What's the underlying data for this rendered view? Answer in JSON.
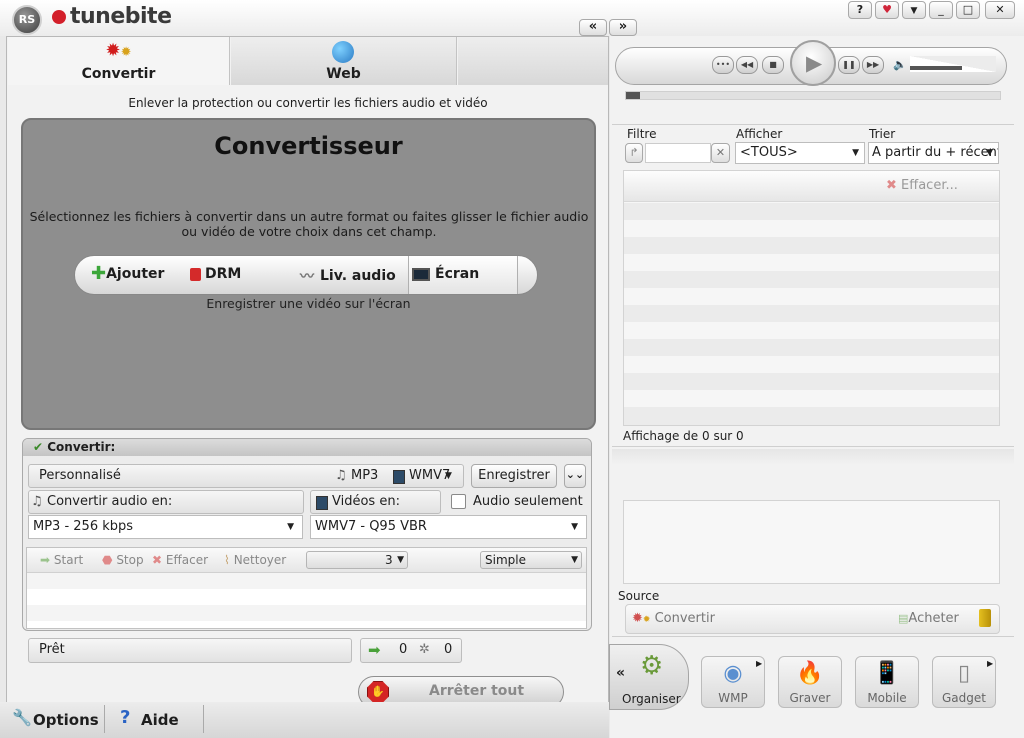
{
  "app": {
    "name": "tunebite",
    "badge": "RS"
  },
  "window_controls": {
    "collapse_left": "«",
    "expand_right": "»",
    "help": "?",
    "minimize": "_",
    "maximize": "□",
    "close": "✕"
  },
  "tabs": [
    {
      "label": "Convertir"
    },
    {
      "label": "Web"
    }
  ],
  "subtitle": "Enlever la protection ou convertir les fichiers audio et vidéo",
  "converter": {
    "title": "Convertisseur",
    "description": "Sélectionnez les fichiers à convertir dans un autre format ou faites glisser le fichier audio ou vidéo de votre choix dans cet champ.",
    "actions": {
      "add": "Ajouter",
      "drm": "DRM",
      "live_audio": "Liv. audio",
      "screen": "Écran"
    },
    "screen_hint": "Enregistrer une vidéo sur l'écran"
  },
  "convert_section": {
    "header": "Convertir:",
    "profile": "Personnalisé",
    "audio_format_badge": "MP3",
    "video_format_badge": "WMV7",
    "record_label": "Enregistrer",
    "audio_label": "Convertir audio en:",
    "video_label": "Vidéos en:",
    "audio_only_label": "Audio seulement",
    "audio_value": "MP3 - 256 kbps",
    "video_value": "WMV7 - Q95 VBR",
    "queue_toolbar": {
      "start": "Start",
      "stop": "Stop",
      "clear": "Effacer",
      "clean": "Nettoyer",
      "threads": "3",
      "mode": "Simple"
    }
  },
  "status": {
    "text": "Prêt",
    "done_count": "0",
    "processing_count": "0"
  },
  "stop_all_label": "Arrêter tout",
  "bottom": {
    "options": "Options",
    "help": "Aide"
  },
  "library": {
    "filter_label": "Filtre",
    "show_label": "Afficher",
    "sort_label": "Trier",
    "show_value": "<TOUS>",
    "sort_value": "A partir du + récent",
    "clear_label": "Effacer...",
    "count_text": "Affichage de 0 sur 0",
    "source_label": "Source",
    "convert_label": "Convertir",
    "buy_label": "Acheter"
  },
  "devices": {
    "organize": "Organiser",
    "wmp": "WMP",
    "burn": "Graver",
    "mobile": "Mobile",
    "gadget": "Gadget"
  },
  "player": {
    "volume_fraction": 0.6
  }
}
